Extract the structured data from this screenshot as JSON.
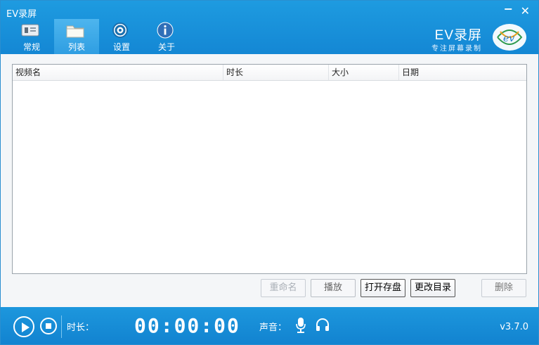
{
  "window": {
    "title": "EV录屏"
  },
  "nav": {
    "items": [
      {
        "label": "常规",
        "icon": "general-icon",
        "active": false
      },
      {
        "label": "列表",
        "icon": "folder-icon",
        "active": true
      },
      {
        "label": "设置",
        "icon": "gear-icon",
        "active": false
      },
      {
        "label": "关于",
        "icon": "info-icon",
        "active": false
      }
    ]
  },
  "brand": {
    "name": "EV录屏",
    "subtitle": "专注屏幕录制"
  },
  "table": {
    "columns": [
      "视频名",
      "时长",
      "大小",
      "日期"
    ],
    "rows": []
  },
  "actions": {
    "rename": "重命名",
    "play": "播放",
    "open_storage": "打开存盘",
    "change_dir": "更改目录",
    "delete": "删除"
  },
  "statusbar": {
    "duration_label": "时长：",
    "timer": "00:00:00",
    "sound_label": "声音：",
    "version": "v3.7.0"
  },
  "colors": {
    "accent": "#1487d4",
    "header": "#1e9be0"
  }
}
